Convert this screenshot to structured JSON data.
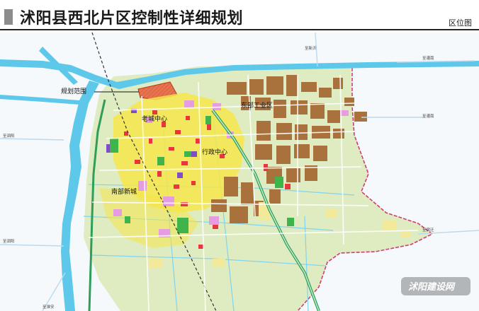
{
  "header": {
    "title": "沭阳县西北片区控制性详细规划",
    "subtitle": "区位图"
  },
  "map": {
    "labels": {
      "plan_scope": "规划范围",
      "old_city": "老城中心",
      "east_industrial": "东部工业区",
      "admin_center": "行政中心",
      "south_new_city": "南部新城"
    },
    "road_labels": [
      "至新沂",
      "至灌南",
      "至灌南",
      "至宿迁",
      "至泗阳",
      "至泗阳",
      "至淮安"
    ],
    "watermark": "沭阳建设网",
    "colors": {
      "water": "#5ec8ea",
      "land": "#dfecc1",
      "plan_area": "#e8734f",
      "industrial": "#a9713c",
      "residential": "#f6e64b",
      "commercial": "#e8363e",
      "public": "#e59ce0",
      "green": "#3fb44a",
      "boundary": "#d03c73"
    }
  }
}
